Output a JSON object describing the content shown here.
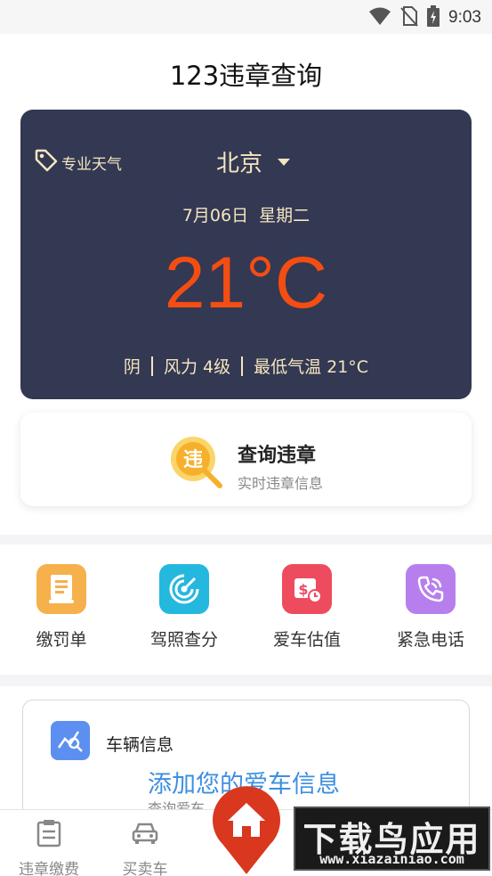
{
  "status_bar": {
    "time": "9:03",
    "icons": [
      "wifi-icon",
      "no-sim-icon",
      "battery-charging-icon"
    ]
  },
  "app": {
    "title": "123违章查询"
  },
  "weather": {
    "tag_label": "专业天气",
    "tag_icon": "tag-icon",
    "city": "北京",
    "date": "7月06日",
    "weekday": "星期二",
    "temperature": "21°C",
    "condition": "阴",
    "wind": "风力 4级",
    "min_temp": "最低气温 21°C",
    "colors": {
      "card": "#333853",
      "text": "#f5e6bf",
      "temperature": "#f44d12"
    }
  },
  "query": {
    "title": "查询违章",
    "subtitle": "实时违章信息",
    "icon_char": "违",
    "icon": "search-violation-icon"
  },
  "services": [
    {
      "label": "缴罚单",
      "icon": "ticket-icon",
      "color": "#f6b04c"
    },
    {
      "label": "驾照查分",
      "icon": "radar-icon",
      "color": "#25b8de"
    },
    {
      "label": "爱车估值",
      "icon": "price-tag-icon",
      "color": "#ee4b5f"
    },
    {
      "label": "紧急电话",
      "icon": "phone-icon",
      "color": "#b77fed"
    }
  ],
  "vehicle": {
    "title": "车辆信息",
    "add_label": "添加您的爱车信息",
    "sub_label": "查询爱车",
    "icon": "chart-search-icon"
  },
  "bottom_nav": [
    {
      "label": "违章缴费",
      "icon": "clipboard-icon"
    },
    {
      "label": "买卖车",
      "icon": "car-icon"
    }
  ],
  "watermark": {
    "big": "下载鸟应用",
    "small": "www.xiazainiao.com"
  }
}
